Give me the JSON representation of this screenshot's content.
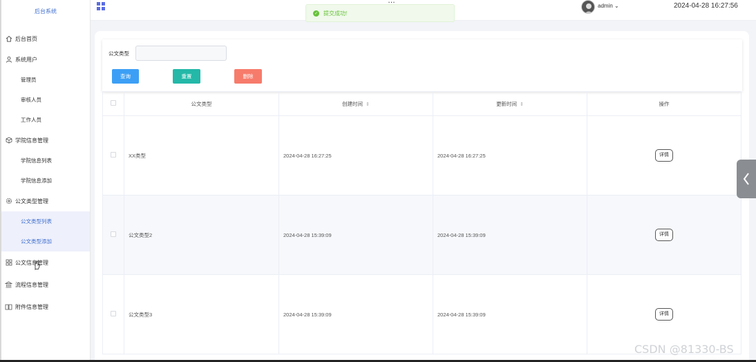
{
  "brand": "后台系统",
  "topbar": {
    "title": "…",
    "user": "admin",
    "clock": "2024-04-28 16:27:56"
  },
  "toast": {
    "text": "提交成功!"
  },
  "sidebar": {
    "home": "后台首页",
    "users": "系统用户",
    "admin": "管理员",
    "reviewer": "审核人员",
    "staff": "工作人员",
    "college": "学院信息管理",
    "college_list": "学院信息列表",
    "college_add": "学院信息添加",
    "doctype": "公文类型管理",
    "doctype_list": "公文类型列表",
    "doctype_add": "公文类型添加",
    "docinfo": "公文信息管理",
    "flow": "流程信息管理",
    "attach": "附件信息管理"
  },
  "filter": {
    "label": "公文类型",
    "value": "",
    "search": "查询",
    "reset": "重置",
    "delete": "删除"
  },
  "table": {
    "headers": {
      "type": "公文类型",
      "created": "创建时间",
      "updated": "更新时间",
      "action": "操作"
    },
    "rows": [
      {
        "type": "XX类型",
        "created": "2024-04-28 16:27:25",
        "updated": "2024-04-28 16:27:25",
        "action": "详情"
      },
      {
        "type": "公文类型2",
        "created": "2024-04-28 15:39:09",
        "updated": "2024-04-28 15:39:09",
        "action": "详情"
      },
      {
        "type": "公文类型3",
        "created": "2024-04-28 15:39:09",
        "updated": "2024-04-28 15:39:09",
        "action": "详情"
      }
    ]
  },
  "watermark": "CSDN @81330-BS",
  "icons": {
    "grid": "grid-icon",
    "check": "check-circle-icon",
    "home": "home-icon",
    "user": "user-icon",
    "cube": "cube-icon",
    "gear": "gear-icon",
    "apps": "apps-icon",
    "bank": "building-icon",
    "book": "book-icon",
    "sort": "sort-icon",
    "chevron": "chevron-left-icon"
  },
  "colors": {
    "accent": "#3f6fd0",
    "search": "#3c9ff5",
    "reset": "#23b8a8",
    "delete": "#f77b6b",
    "success": "#67c23a"
  }
}
